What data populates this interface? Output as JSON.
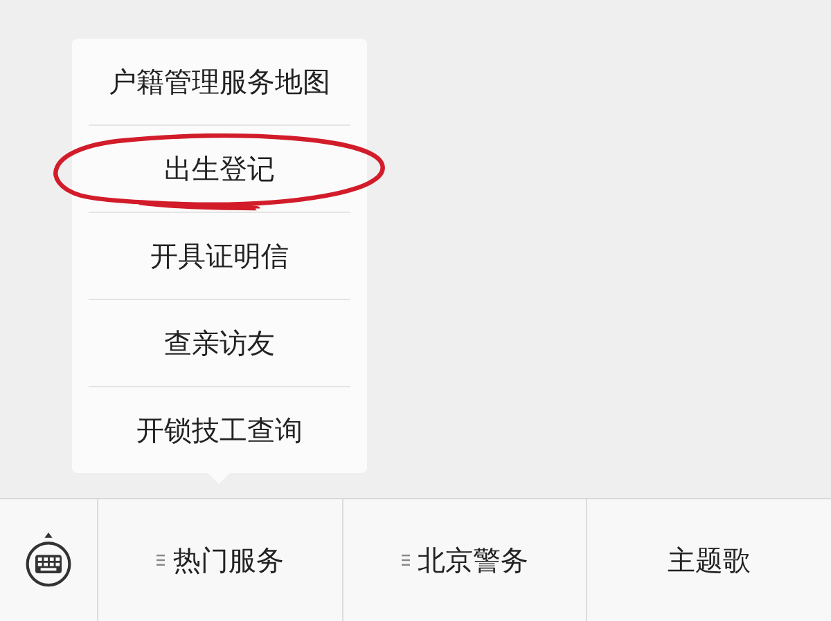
{
  "popup_menu": {
    "items": [
      {
        "label": "户籍管理服务地图",
        "circled": false
      },
      {
        "label": "出生登记",
        "circled": true
      },
      {
        "label": "开具证明信",
        "circled": false
      },
      {
        "label": "查亲访友",
        "circled": false
      },
      {
        "label": "开锁技工查询",
        "circled": false
      }
    ]
  },
  "bottom_bar": {
    "menus": [
      {
        "label": "热门服务",
        "has_submenu": true
      },
      {
        "label": "北京警务",
        "has_submenu": true
      },
      {
        "label": "主题歌",
        "has_submenu": false
      }
    ]
  }
}
